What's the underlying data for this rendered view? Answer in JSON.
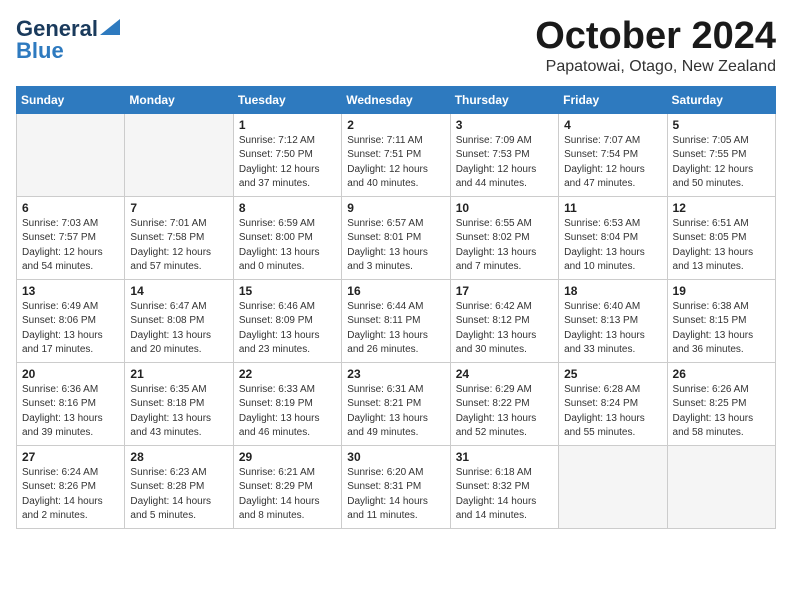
{
  "header": {
    "logo_general": "General",
    "logo_blue": "Blue",
    "month": "October 2024",
    "location": "Papatowai, Otago, New Zealand"
  },
  "days_of_week": [
    "Sunday",
    "Monday",
    "Tuesday",
    "Wednesday",
    "Thursday",
    "Friday",
    "Saturday"
  ],
  "weeks": [
    [
      {
        "day": "",
        "empty": true
      },
      {
        "day": "",
        "empty": true
      },
      {
        "day": "1",
        "sunrise": "Sunrise: 7:12 AM",
        "sunset": "Sunset: 7:50 PM",
        "daylight": "Daylight: 12 hours and 37 minutes."
      },
      {
        "day": "2",
        "sunrise": "Sunrise: 7:11 AM",
        "sunset": "Sunset: 7:51 PM",
        "daylight": "Daylight: 12 hours and 40 minutes."
      },
      {
        "day": "3",
        "sunrise": "Sunrise: 7:09 AM",
        "sunset": "Sunset: 7:53 PM",
        "daylight": "Daylight: 12 hours and 44 minutes."
      },
      {
        "day": "4",
        "sunrise": "Sunrise: 7:07 AM",
        "sunset": "Sunset: 7:54 PM",
        "daylight": "Daylight: 12 hours and 47 minutes."
      },
      {
        "day": "5",
        "sunrise": "Sunrise: 7:05 AM",
        "sunset": "Sunset: 7:55 PM",
        "daylight": "Daylight: 12 hours and 50 minutes."
      }
    ],
    [
      {
        "day": "6",
        "sunrise": "Sunrise: 7:03 AM",
        "sunset": "Sunset: 7:57 PM",
        "daylight": "Daylight: 12 hours and 54 minutes."
      },
      {
        "day": "7",
        "sunrise": "Sunrise: 7:01 AM",
        "sunset": "Sunset: 7:58 PM",
        "daylight": "Daylight: 12 hours and 57 minutes."
      },
      {
        "day": "8",
        "sunrise": "Sunrise: 6:59 AM",
        "sunset": "Sunset: 8:00 PM",
        "daylight": "Daylight: 13 hours and 0 minutes."
      },
      {
        "day": "9",
        "sunrise": "Sunrise: 6:57 AM",
        "sunset": "Sunset: 8:01 PM",
        "daylight": "Daylight: 13 hours and 3 minutes."
      },
      {
        "day": "10",
        "sunrise": "Sunrise: 6:55 AM",
        "sunset": "Sunset: 8:02 PM",
        "daylight": "Daylight: 13 hours and 7 minutes."
      },
      {
        "day": "11",
        "sunrise": "Sunrise: 6:53 AM",
        "sunset": "Sunset: 8:04 PM",
        "daylight": "Daylight: 13 hours and 10 minutes."
      },
      {
        "day": "12",
        "sunrise": "Sunrise: 6:51 AM",
        "sunset": "Sunset: 8:05 PM",
        "daylight": "Daylight: 13 hours and 13 minutes."
      }
    ],
    [
      {
        "day": "13",
        "sunrise": "Sunrise: 6:49 AM",
        "sunset": "Sunset: 8:06 PM",
        "daylight": "Daylight: 13 hours and 17 minutes."
      },
      {
        "day": "14",
        "sunrise": "Sunrise: 6:47 AM",
        "sunset": "Sunset: 8:08 PM",
        "daylight": "Daylight: 13 hours and 20 minutes."
      },
      {
        "day": "15",
        "sunrise": "Sunrise: 6:46 AM",
        "sunset": "Sunset: 8:09 PM",
        "daylight": "Daylight: 13 hours and 23 minutes."
      },
      {
        "day": "16",
        "sunrise": "Sunrise: 6:44 AM",
        "sunset": "Sunset: 8:11 PM",
        "daylight": "Daylight: 13 hours and 26 minutes."
      },
      {
        "day": "17",
        "sunrise": "Sunrise: 6:42 AM",
        "sunset": "Sunset: 8:12 PM",
        "daylight": "Daylight: 13 hours and 30 minutes."
      },
      {
        "day": "18",
        "sunrise": "Sunrise: 6:40 AM",
        "sunset": "Sunset: 8:13 PM",
        "daylight": "Daylight: 13 hours and 33 minutes."
      },
      {
        "day": "19",
        "sunrise": "Sunrise: 6:38 AM",
        "sunset": "Sunset: 8:15 PM",
        "daylight": "Daylight: 13 hours and 36 minutes."
      }
    ],
    [
      {
        "day": "20",
        "sunrise": "Sunrise: 6:36 AM",
        "sunset": "Sunset: 8:16 PM",
        "daylight": "Daylight: 13 hours and 39 minutes."
      },
      {
        "day": "21",
        "sunrise": "Sunrise: 6:35 AM",
        "sunset": "Sunset: 8:18 PM",
        "daylight": "Daylight: 13 hours and 43 minutes."
      },
      {
        "day": "22",
        "sunrise": "Sunrise: 6:33 AM",
        "sunset": "Sunset: 8:19 PM",
        "daylight": "Daylight: 13 hours and 46 minutes."
      },
      {
        "day": "23",
        "sunrise": "Sunrise: 6:31 AM",
        "sunset": "Sunset: 8:21 PM",
        "daylight": "Daylight: 13 hours and 49 minutes."
      },
      {
        "day": "24",
        "sunrise": "Sunrise: 6:29 AM",
        "sunset": "Sunset: 8:22 PM",
        "daylight": "Daylight: 13 hours and 52 minutes."
      },
      {
        "day": "25",
        "sunrise": "Sunrise: 6:28 AM",
        "sunset": "Sunset: 8:24 PM",
        "daylight": "Daylight: 13 hours and 55 minutes."
      },
      {
        "day": "26",
        "sunrise": "Sunrise: 6:26 AM",
        "sunset": "Sunset: 8:25 PM",
        "daylight": "Daylight: 13 hours and 58 minutes."
      }
    ],
    [
      {
        "day": "27",
        "sunrise": "Sunrise: 6:24 AM",
        "sunset": "Sunset: 8:26 PM",
        "daylight": "Daylight: 14 hours and 2 minutes."
      },
      {
        "day": "28",
        "sunrise": "Sunrise: 6:23 AM",
        "sunset": "Sunset: 8:28 PM",
        "daylight": "Daylight: 14 hours and 5 minutes."
      },
      {
        "day": "29",
        "sunrise": "Sunrise: 6:21 AM",
        "sunset": "Sunset: 8:29 PM",
        "daylight": "Daylight: 14 hours and 8 minutes."
      },
      {
        "day": "30",
        "sunrise": "Sunrise: 6:20 AM",
        "sunset": "Sunset: 8:31 PM",
        "daylight": "Daylight: 14 hours and 11 minutes."
      },
      {
        "day": "31",
        "sunrise": "Sunrise: 6:18 AM",
        "sunset": "Sunset: 8:32 PM",
        "daylight": "Daylight: 14 hours and 14 minutes."
      },
      {
        "day": "",
        "empty": true
      },
      {
        "day": "",
        "empty": true
      }
    ]
  ]
}
